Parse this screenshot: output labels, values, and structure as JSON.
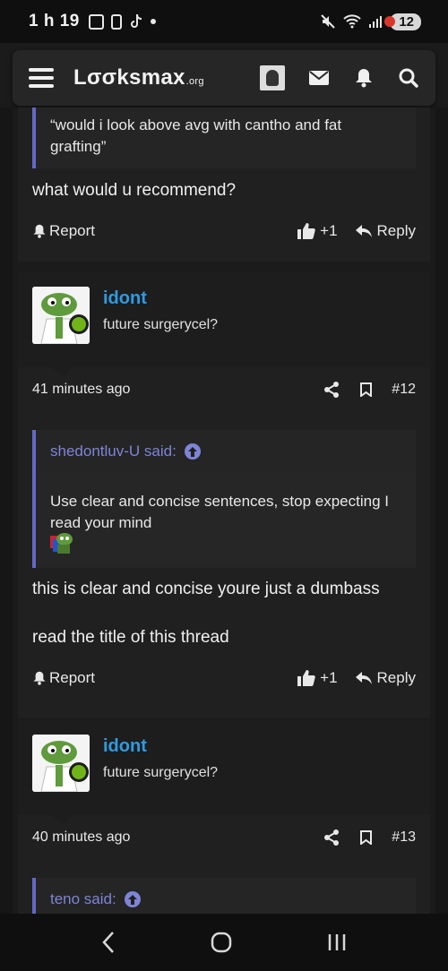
{
  "status_bar": {
    "time": "1 h 19",
    "battery": "12"
  },
  "navbar": {
    "logo": "Lσσksmax",
    "logo_suffix": ".org"
  },
  "posts": {
    "top": {
      "quote": "“would i look above avg with cantho and fat grafting”",
      "message": "what would u recommend?",
      "report": "Report",
      "likes": "+1",
      "reply": "Reply"
    },
    "p12": {
      "username": "idont",
      "user_title": "future surgerycel?",
      "time": "41 minutes ago",
      "number": "#12",
      "quote_author": "shedontluv-U said:",
      "quote_text": "Use clear and concise sentences, stop expecting I read your mind",
      "message_1": "this is clear and concise youre just a dumbass",
      "message_2": "read the title of this thread",
      "report": "Report",
      "likes": "+1",
      "reply": "Reply"
    },
    "p13": {
      "username": "idont",
      "user_title": "future surgerycel?",
      "time": "40 minutes ago",
      "number": "#13",
      "quote_author": "teno said:"
    }
  },
  "colors": {
    "accent_username": "#2f9be0",
    "quote_bar": "#6369c2",
    "online": "#6fb517"
  }
}
